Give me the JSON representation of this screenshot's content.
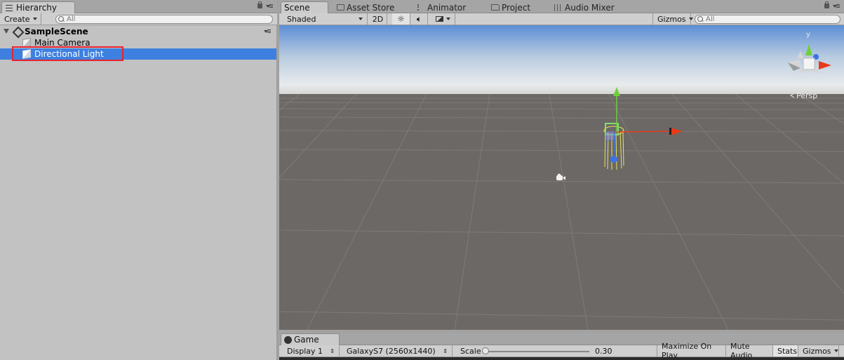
{
  "hierarchy": {
    "tab_label": "Hierarchy",
    "create_label": "Create",
    "search_placeholder": "All",
    "scene_name": "SampleScene",
    "items": [
      {
        "label": "Main Camera"
      },
      {
        "label": "Directional Light",
        "selected": true
      }
    ]
  },
  "tabs": {
    "scene": "Scene",
    "asset_store": "Asset Store",
    "animator": "Animator",
    "project": "Project",
    "audio_mixer": "Audio Mixer"
  },
  "scene_toolbar": {
    "shading_mode": "Shaded",
    "mode_2d": "2D",
    "gizmos_label": "Gizmos",
    "search_placeholder": "All"
  },
  "scene_view": {
    "orientation_gizmo_axis": "y",
    "projection_label": "Persp"
  },
  "game": {
    "tab_label": "Game",
    "display": "Display 1",
    "resolution": "GalaxyS7 (2560x1440)",
    "scale_label": "Scale",
    "scale_value": "0.30",
    "maximize_on_play": "Maximize On Play",
    "mute_audio": "Mute Audio",
    "stats": "Stats",
    "gizmos": "Gizmos"
  },
  "colors": {
    "selection": "#3d80df",
    "highlight_box": "#e8232f",
    "x_axis": "#e83a1a",
    "y_axis": "#6fcf3a",
    "z_axis": "#3a74e8"
  }
}
